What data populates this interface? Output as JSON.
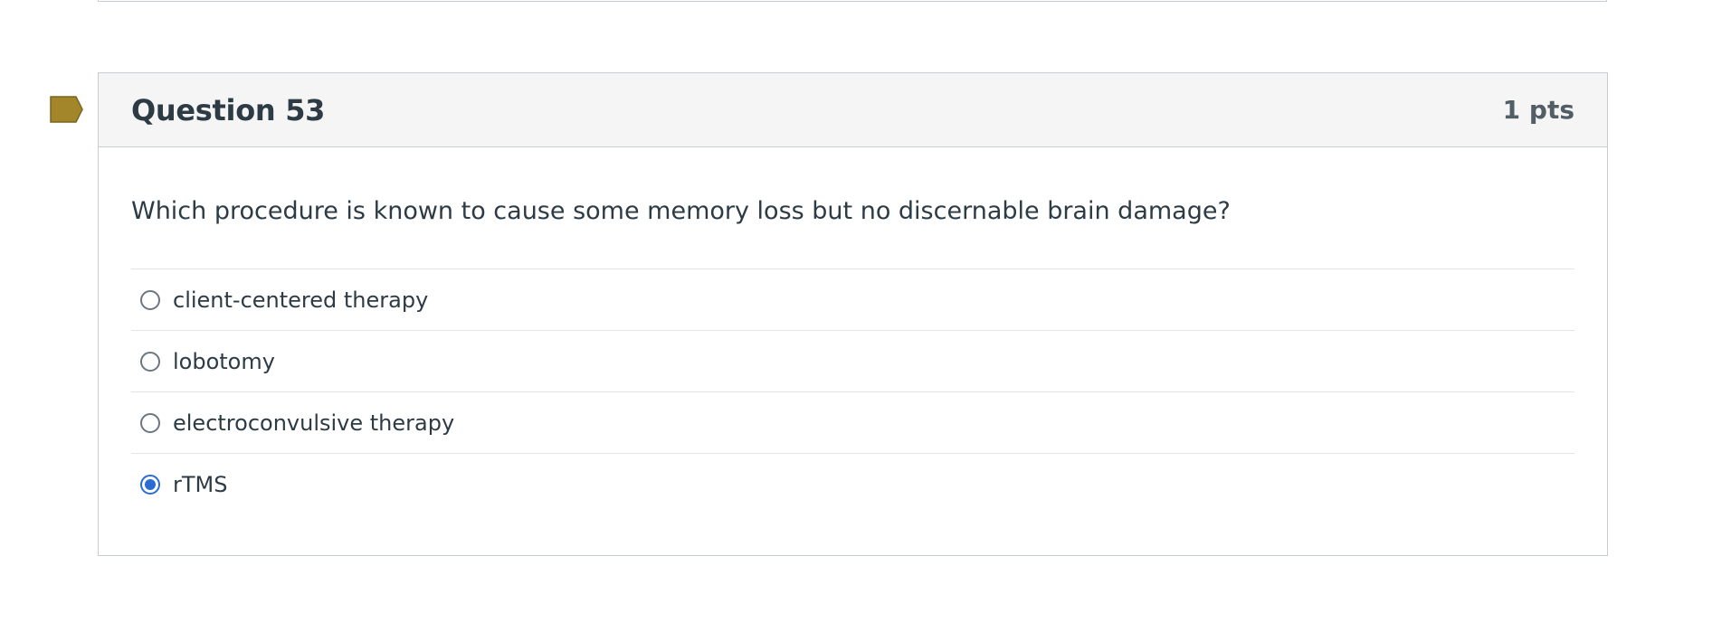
{
  "question": {
    "title": "Question 53",
    "points": "1 pts",
    "text": "Which procedure is known to cause some memory loss but no discernable brain damage?",
    "flag_color": "#a4862a",
    "answers": [
      {
        "label": "client-centered therapy",
        "selected": false
      },
      {
        "label": "lobotomy",
        "selected": false
      },
      {
        "label": "electroconvulsive therapy",
        "selected": false
      },
      {
        "label": "rTMS",
        "selected": true
      }
    ]
  }
}
